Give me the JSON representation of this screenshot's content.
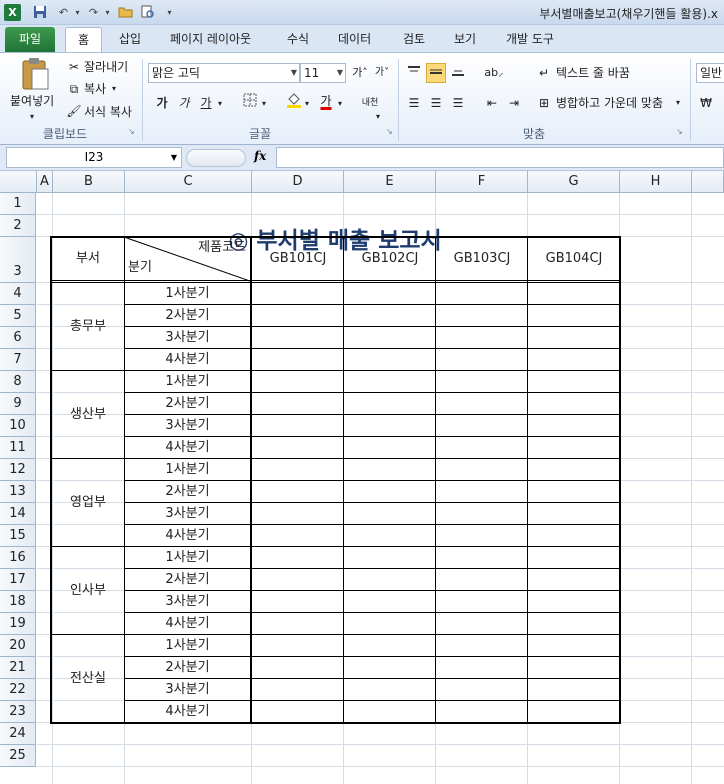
{
  "window_title": "부서별매출보고(채우기핸들 활용).x",
  "qat": {
    "excel_icon": "X",
    "save_icon": "save-icon",
    "undo_icon": "undo-icon",
    "redo_icon": "redo-icon",
    "open_icon": "folder-icon",
    "preview_icon": "print-preview-icon"
  },
  "tabs": [
    "파일",
    "홈",
    "삽입",
    "페이지 레이아웃",
    "수식",
    "데이터",
    "검토",
    "보기",
    "개발 도구"
  ],
  "ribbon": {
    "clipboard": {
      "paste": "붙여넣기",
      "cut": "잘라내기",
      "copy": "복사",
      "format_painter": "서식 복사",
      "label": "클립보드"
    },
    "font": {
      "name": "맑은 고딕",
      "size": "11",
      "bold": "가",
      "italic": "가",
      "underline": "가",
      "font_color_letter": "가",
      "phonetic": "내천",
      "label": "글꼴"
    },
    "alignment": {
      "wrap": "텍스트 줄 바꿈",
      "merge": "병합하고 가운데 맞춤",
      "label": "맞춤"
    },
    "number": {
      "format": "일반"
    }
  },
  "formula_bar": {
    "cell_ref": "I23",
    "fx": "fx",
    "value": ""
  },
  "columns": [
    "A",
    "B",
    "C",
    "D",
    "E",
    "F",
    "G",
    "H"
  ],
  "rows": [
    "1",
    "2",
    "3",
    "4",
    "5",
    "6",
    "7",
    "8",
    "9",
    "10",
    "11",
    "12",
    "13",
    "14",
    "15",
    "16",
    "17",
    "18",
    "19",
    "20",
    "21",
    "22",
    "23",
    "24",
    "25"
  ],
  "sheet": {
    "title": "◎ 부서별 매출 보고서",
    "header": {
      "dept": "부서",
      "product_code": "제품코드",
      "quarter": "분기",
      "codes": [
        "GB101CJ",
        "GB102CJ",
        "GB103CJ",
        "GB104CJ"
      ]
    },
    "departments": [
      "총무부",
      "생산부",
      "영업부",
      "인사부",
      "전산실"
    ],
    "quarters": [
      "1사분기",
      "2사분기",
      "3사분기",
      "4사분기"
    ]
  }
}
